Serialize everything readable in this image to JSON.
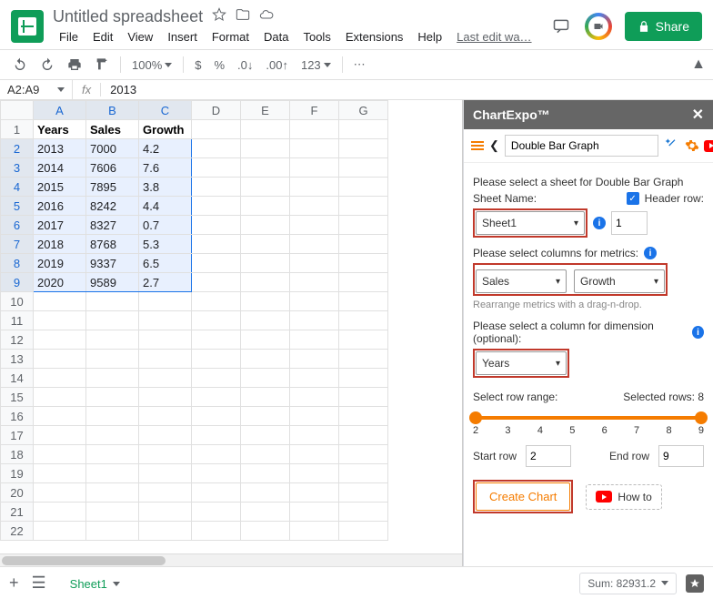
{
  "header": {
    "title": "Untitled spreadsheet",
    "menus": [
      "File",
      "Edit",
      "View",
      "Insert",
      "Format",
      "Data",
      "Tools",
      "Extensions",
      "Help"
    ],
    "last_edit": "Last edit wa…",
    "share": "Share"
  },
  "toolbar": {
    "zoom": "100%",
    "fmt": "123"
  },
  "namebox": "A2:A9",
  "formula": "2013",
  "columns": [
    "A",
    "B",
    "C",
    "D",
    "E",
    "F",
    "G"
  ],
  "table": {
    "headers": [
      "Years",
      "Sales",
      "Growth"
    ],
    "rows": [
      [
        "2013",
        "7000",
        "4.2"
      ],
      [
        "2014",
        "7606",
        "7.6"
      ],
      [
        "2015",
        "7895",
        "3.8"
      ],
      [
        "2016",
        "8242",
        "4.4"
      ],
      [
        "2017",
        "8327",
        "0.7"
      ],
      [
        "2018",
        "8768",
        "5.3"
      ],
      [
        "2019",
        "9337",
        "6.5"
      ],
      [
        "2020",
        "9589",
        "2.7"
      ]
    ]
  },
  "total_rows": 22,
  "sidepanel": {
    "title": "ChartExpo™",
    "chart_name": "Double Bar Graph",
    "prompt_sheet": "Please select a sheet for Double Bar Graph",
    "sheet_label": "Sheet Name:",
    "header_row_label": "Header row:",
    "sheet_value": "Sheet1",
    "header_row_value": "1",
    "prompt_metrics": "Please select columns for metrics:",
    "metric1": "Sales",
    "metric2": "Growth",
    "rearrange": "Rearrange metrics with a drag-n-drop.",
    "prompt_dimension": "Please select a column for dimension (optional):",
    "dimension": "Years",
    "range_label": "Select row range:",
    "selected_rows": "Selected rows: 8",
    "ticks": [
      "2",
      "3",
      "4",
      "5",
      "6",
      "7",
      "8",
      "9"
    ],
    "start_label": "Start row",
    "start_value": "2",
    "end_label": "End row",
    "end_value": "9",
    "create": "Create Chart",
    "howto": "How to"
  },
  "footer": {
    "sheet": "Sheet1",
    "sum": "Sum: 82931.2"
  }
}
